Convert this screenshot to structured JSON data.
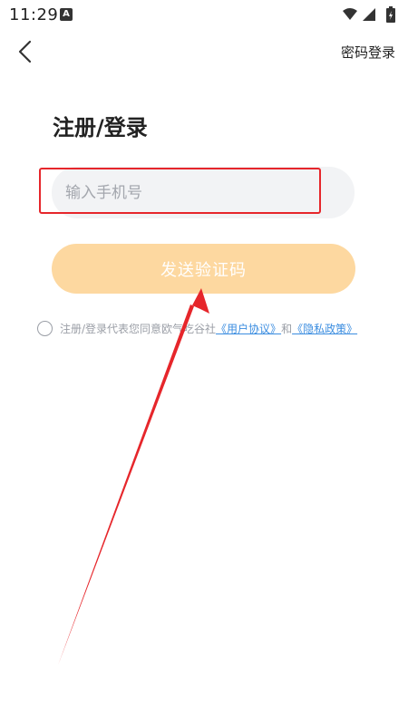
{
  "status_bar": {
    "time": "11:29",
    "notification_icon": "a-icon",
    "wifi_icon": "wifi-icon",
    "signal_icon": "signal-icon",
    "battery_icon": "battery-icon"
  },
  "header": {
    "back_icon": "chevron-left-icon",
    "password_login_label": "密码登录"
  },
  "main": {
    "title": "注册/登录",
    "phone_placeholder": "输入手机号",
    "send_code_label": "发送验证码"
  },
  "agreement": {
    "prefix": "注册/登录代表您同意欧气吃谷社",
    "user_agreement_link": "《用户协议》",
    "conjunction": "和",
    "privacy_policy_link": "《隐私政策》"
  },
  "colors": {
    "button_bg": "#fdd8a0",
    "link": "#3b8de0",
    "annotation_red": "#e6262b",
    "input_bg": "#f2f3f5"
  }
}
